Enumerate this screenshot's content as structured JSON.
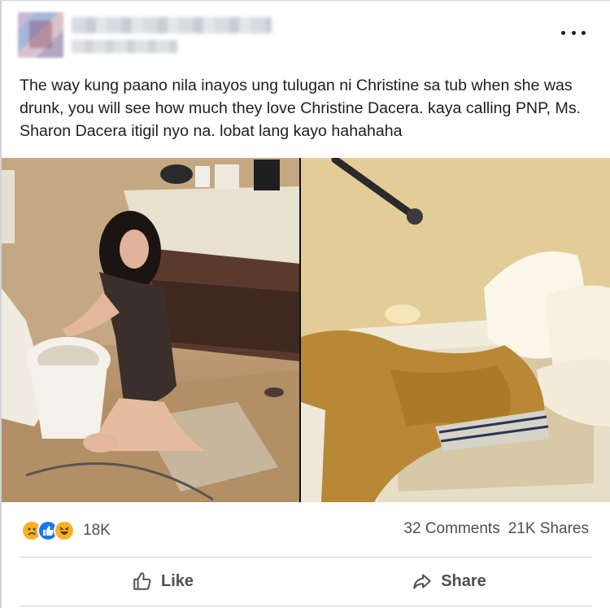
{
  "post": {
    "caption": "The way kung paano nila inayos ung tulugan ni Christine sa tub when she was drunk, you will see how much they love Christine Dacera. kaya calling PNP, Ms. Sharon Dacera itigil nyo na. lobat lang kayo hahahaha"
  },
  "reactions": {
    "icons": [
      "sad-icon",
      "like-icon",
      "haha-icon"
    ],
    "count": "18K"
  },
  "stats": {
    "comments": "32 Comments",
    "shares": "21K Shares"
  },
  "actions": {
    "like_label": "Like",
    "share_label": "Share"
  },
  "colors": {
    "like_blue": "#1877f2",
    "reaction_yellow": "#f7b125",
    "text_secondary": "#4b4f56"
  }
}
